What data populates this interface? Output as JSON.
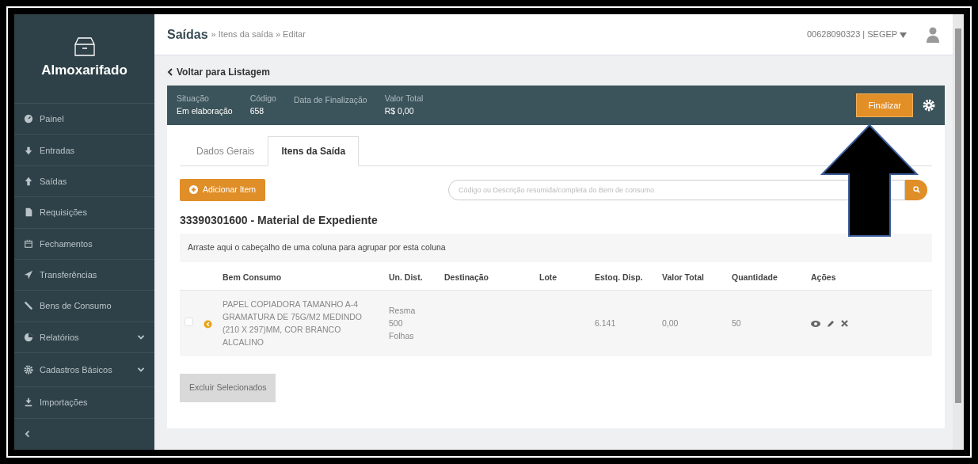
{
  "sidebar": {
    "title": "Almoxarifado",
    "items": [
      {
        "label": "Painel",
        "expandable": false
      },
      {
        "label": "Entradas",
        "expandable": false
      },
      {
        "label": "Saídas",
        "expandable": false
      },
      {
        "label": "Requisições",
        "expandable": false
      },
      {
        "label": "Fechamentos",
        "expandable": false
      },
      {
        "label": "Transferências",
        "expandable": false
      },
      {
        "label": "Bens de Consumo",
        "expandable": false
      },
      {
        "label": "Relatórios",
        "expandable": true
      },
      {
        "label": "Cadastros Básicos",
        "expandable": true
      },
      {
        "label": "Importações",
        "expandable": false
      }
    ]
  },
  "header": {
    "title": "Saídas",
    "trail": "» Itens da saída » Editar",
    "user": "00628090323 | SEGEP"
  },
  "back_link": "Voltar para Listagem",
  "summary": {
    "fields": [
      {
        "label": "Situação",
        "value": "Em elaboração"
      },
      {
        "label": "Código",
        "value": "658"
      },
      {
        "label": "Data de Finalização"
      },
      {
        "label": "Valor Total",
        "value": "R$ 0,00"
      }
    ],
    "button": "Finalizar"
  },
  "tabs": [
    {
      "label": "Dados Gerais",
      "selected": false
    },
    {
      "label": "Itens da Saída",
      "selected": true
    }
  ],
  "add_button": "Adicionar Item",
  "search": {
    "placeholder": "Código ou Descrição resumida/completa do Bem de consumo"
  },
  "group_title": "33390301600 - Material de Expediente",
  "group_hint": "Arraste aqui o cabeçalho de uma coluna para agrupar por esta coluna",
  "table": {
    "columns": [
      "Bem Consumo",
      "Un. Dist.",
      "Destinação",
      "Lote",
      "Estoq. Disp.",
      "Valor Total",
      "Quantidade",
      "Ações"
    ],
    "rows": [
      {
        "checked": false,
        "item": "PAPEL COPIADORA TAMANHO A-4 GRAMATURA DE 75G/M2 MEDINDO (210 X 297)MM, COR BRANCO ALCALINO",
        "unit": "Resma 500 Folhas",
        "stock": "6.141",
        "total": "0,00",
        "quantity": "50"
      }
    ]
  },
  "delete_button": {
    "label": "Excluir Selecionados",
    "disabled": true
  }
}
